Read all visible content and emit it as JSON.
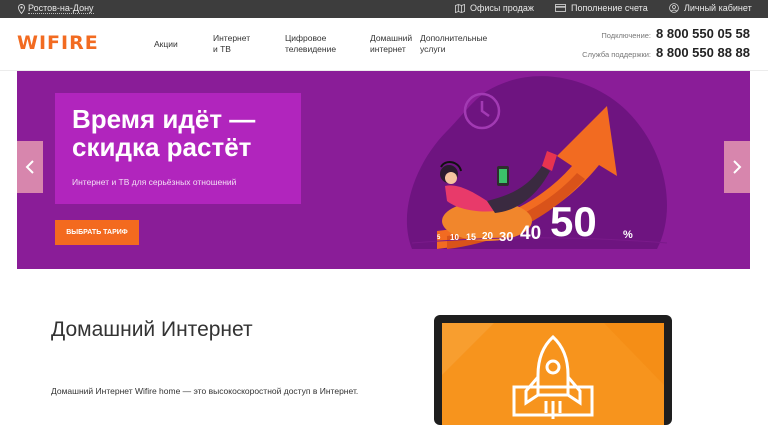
{
  "topbar": {
    "city": "Ростов-на-Дону",
    "offices": "Офисы продаж",
    "topup": "Пополнение счета",
    "account": "Личный кабинет"
  },
  "header": {
    "logo": "WIFIRE",
    "nav": [
      {
        "line1": "Акции",
        "line2": ""
      },
      {
        "line1": "Интернет",
        "line2": "и ТВ"
      },
      {
        "line1": "Цифровое",
        "line2": "телевидение"
      },
      {
        "line1": "Домашний",
        "line2": "интернет"
      },
      {
        "line1": "Дополнительные",
        "line2": "услуги"
      }
    ],
    "phones": [
      {
        "label": "Подключение:",
        "number": "8 800 550 05 58"
      },
      {
        "label": "Служба поддержки:",
        "number": "8 800 550 88 88"
      }
    ]
  },
  "banner": {
    "title_line1": "Время идёт —",
    "title_line2": "скидка растёт",
    "subtitle": "Интернет и ТВ для серьёзных отношений",
    "cta": "ВЫБРАТЬ ТАРИФ",
    "scale": [
      "5",
      "10",
      "15",
      "20",
      "30",
      "40",
      "50",
      "%"
    ]
  },
  "section": {
    "title": "Домашний Интернет",
    "description": "Домашний Интернет Wifire home — это высокоскоростной доступ в Интернет."
  },
  "colors": {
    "brand_orange": "#f26b21",
    "banner_purple": "#8a1d98",
    "promo_purple": "#b125bd",
    "topbar": "#3d3d3d"
  }
}
